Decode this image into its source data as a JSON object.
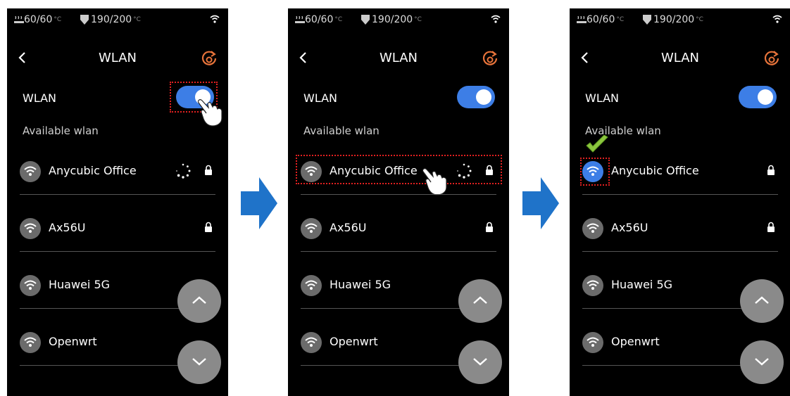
{
  "status": {
    "bed_temp": "60/60",
    "nozzle_temp": "190/200",
    "temp_unit": "°C"
  },
  "header": {
    "title": "WLAN"
  },
  "wlan": {
    "label": "WLAN",
    "enabled": true
  },
  "available_label": "Available wlan",
  "networks": [
    {
      "name": "Anycubic Office",
      "locked": true
    },
    {
      "name": "Ax56U",
      "locked": true
    },
    {
      "name": "Huawei 5G",
      "locked": false
    },
    {
      "name": "Openwrt",
      "locked": false
    }
  ],
  "colors": {
    "accent": "#3d7ee6",
    "highlight": "#e02020",
    "step_arrow": "#1f73c9",
    "check": "#8cc63f",
    "refresh_icon": "#e8743b"
  },
  "icons": {
    "back": "chevron-left-icon",
    "refresh": "reset-icon",
    "wifi": "wifi-icon",
    "lock": "lock-icon",
    "scroll_up": "chevron-up-icon",
    "scroll_down": "chevron-down-icon"
  }
}
